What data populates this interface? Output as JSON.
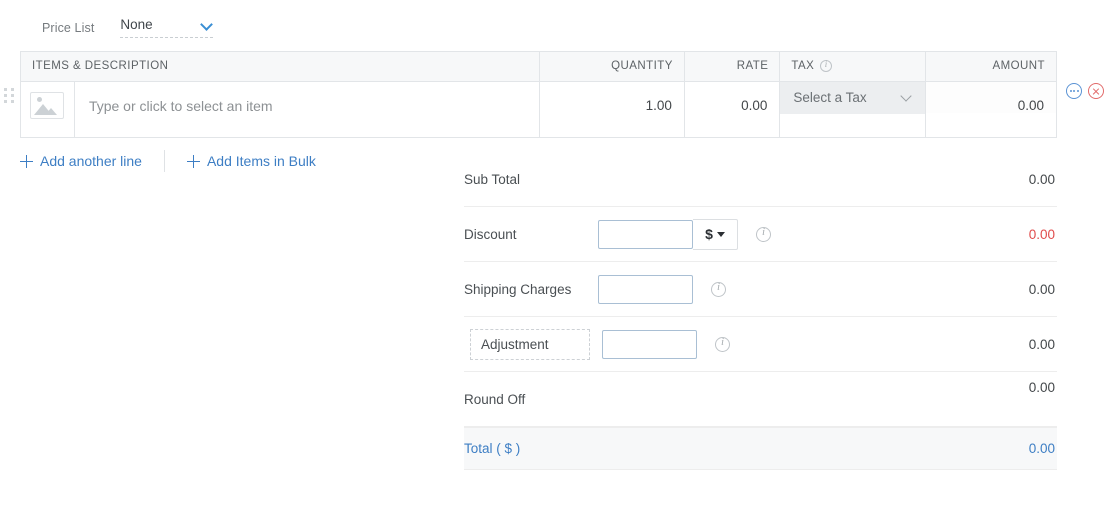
{
  "price_list": {
    "label": "Price List",
    "value": "None",
    "caret_icon": "chevron-down-icon"
  },
  "items_table": {
    "headers": [
      "ITEMS & DESCRIPTION",
      "QUANTITY",
      "RATE",
      "TAX",
      "AMOUNT"
    ],
    "tax_header_info_icon": "info-icon",
    "row": {
      "image_placeholder_icon": "image-placeholder-icon",
      "item_placeholder": "Type or click to select an item",
      "quantity": "1.00",
      "rate": "0.00",
      "tax": "Select a Tax",
      "amount": "0.00"
    },
    "actions": {
      "more_icon": "more-options-icon",
      "delete_icon": "delete-row-icon"
    },
    "drag_handle_icon": "drag-handle-icon"
  },
  "add_links": {
    "add_line": "Add another line",
    "add_bulk": "Add Items in Bulk",
    "plus_icon": "plus-icon"
  },
  "summary": {
    "sub_total": {
      "label": "Sub Total",
      "value": "0.00"
    },
    "discount": {
      "label": "Discount",
      "input_value": "",
      "currency_symbol": "$",
      "value": "0.00",
      "info_icon": "info-icon"
    },
    "shipping": {
      "label": "Shipping Charges",
      "input_value": "",
      "value": "0.00",
      "info_icon": "info-icon"
    },
    "adjustment": {
      "label": "Adjustment",
      "input_value": "",
      "value": "0.00",
      "info_icon": "info-icon"
    },
    "round_off": {
      "label": "Round Off",
      "value": "0.00"
    },
    "total": {
      "label": "Total ( $ )",
      "value": "0.00"
    }
  },
  "colors": {
    "link_blue": "#3d7ec4",
    "negative_red": "#e04b4b",
    "text": "#43474a",
    "header_bg": "#f7f8f9",
    "border": "#e2e5e8"
  }
}
